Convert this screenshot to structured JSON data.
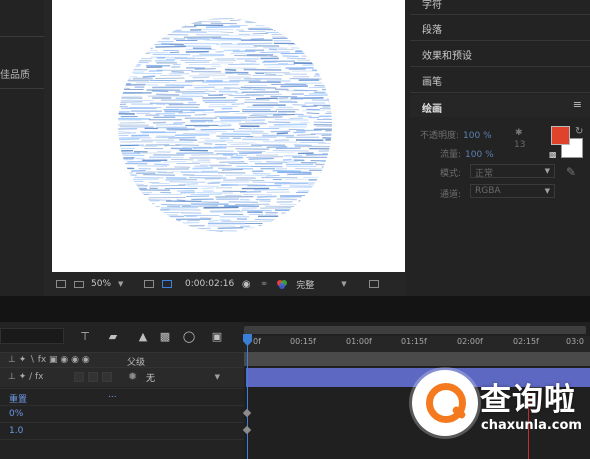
{
  "left_panel": {
    "label": "佳品质"
  },
  "viewer": {
    "zoom": "50%",
    "timecode": "0:00:02:16",
    "resolution": "完整"
  },
  "right_panel": {
    "sections": [
      "字符",
      "段落",
      "效果和预设",
      "画笔"
    ],
    "paint": {
      "title": "绘画",
      "menu": "≡",
      "opacity_label": "不透明度:",
      "opacity_value": "100 %",
      "flow_label": "流量:",
      "flow_value": "100 %",
      "brush_size": "13",
      "mode_label": "模式:",
      "mode_value": "正常",
      "channel_label": "通道:",
      "channel_value": "RGBA",
      "fg_color": "#e0432b",
      "bg_color": "#ffffff"
    }
  },
  "timeline": {
    "column_parent": "父级",
    "parent_value": "无",
    "ruler": [
      "0f",
      "00:15f",
      "01:00f",
      "01:15f",
      "02:00f",
      "02:15f",
      "03:0"
    ],
    "properties": [
      {
        "label": "重置",
        "extra": "..."
      },
      {
        "label": "0%"
      },
      {
        "label": "1.0"
      }
    ]
  },
  "watermark": {
    "title": "查询啦",
    "url": "chaxunla.com"
  }
}
